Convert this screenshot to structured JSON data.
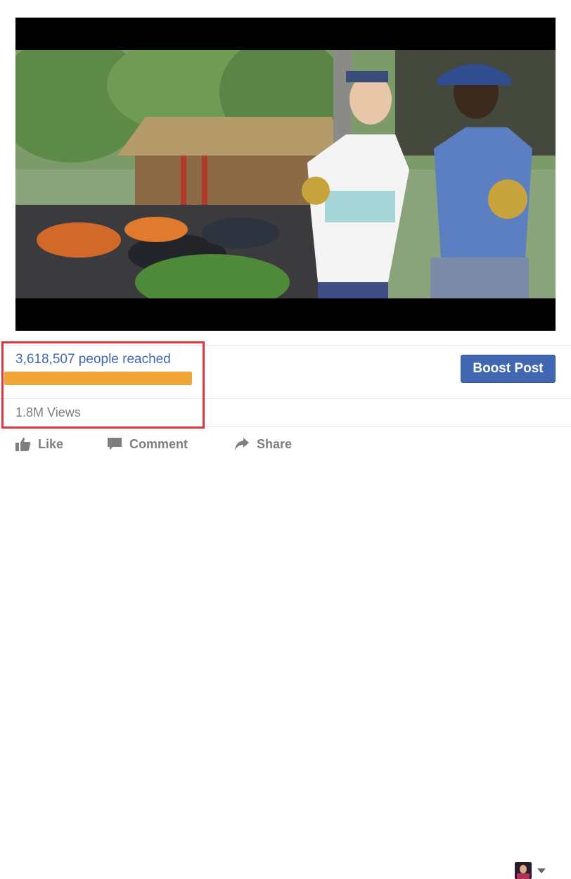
{
  "post": {
    "reach_text": "3,618,507 people reached",
    "reach_fraction": 1.0,
    "views_text": "1.8M Views",
    "boost_label": "Boost Post"
  },
  "actions": {
    "like": "Like",
    "comment": "Comment",
    "share": "Share"
  },
  "colors": {
    "link": "#4267b2",
    "bar": "#f2a537",
    "highlight": "#d9363e"
  },
  "icons": [
    "like-icon",
    "comment-icon",
    "share-icon",
    "caret-down-icon"
  ]
}
